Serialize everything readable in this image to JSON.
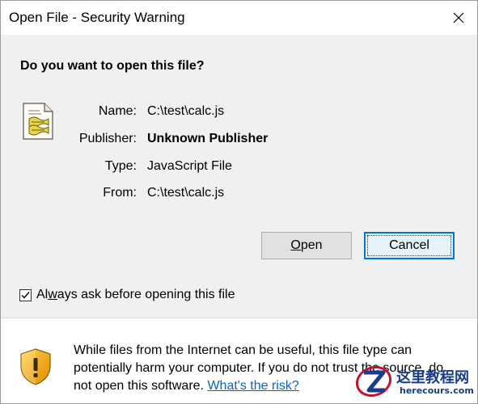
{
  "window": {
    "title": "Open File - Security Warning"
  },
  "dialog": {
    "question": "Do you want to open this file?",
    "fields": [
      {
        "label": "Name:",
        "value": "C:\\test\\calc.js",
        "bold": false
      },
      {
        "label": "Publisher:",
        "value": "Unknown Publisher",
        "bold": true
      },
      {
        "label": "Type:",
        "value": "JavaScript File",
        "bold": false
      },
      {
        "label": "From:",
        "value": "C:\\test\\calc.js",
        "bold": false
      }
    ],
    "buttons": {
      "open": {
        "mnemonic": "O",
        "rest": "pen"
      },
      "cancel": {
        "label": "Cancel"
      }
    },
    "checkbox": {
      "checked": true,
      "label_before": "Al",
      "label_mnemonic": "w",
      "label_after": "ays ask before opening this file"
    },
    "warning": {
      "text": "While files from the Internet can be useful, this file type can potentially harm your computer. If you do not trust the source, do not open this software.",
      "link": "What's the risk?"
    }
  },
  "watermark": {
    "title": "这里教程网",
    "subtitle": "herecours.com"
  },
  "colors": {
    "link": "#0066cc",
    "focus_border": "#0078d7",
    "watermark": "#1a3c8c"
  }
}
